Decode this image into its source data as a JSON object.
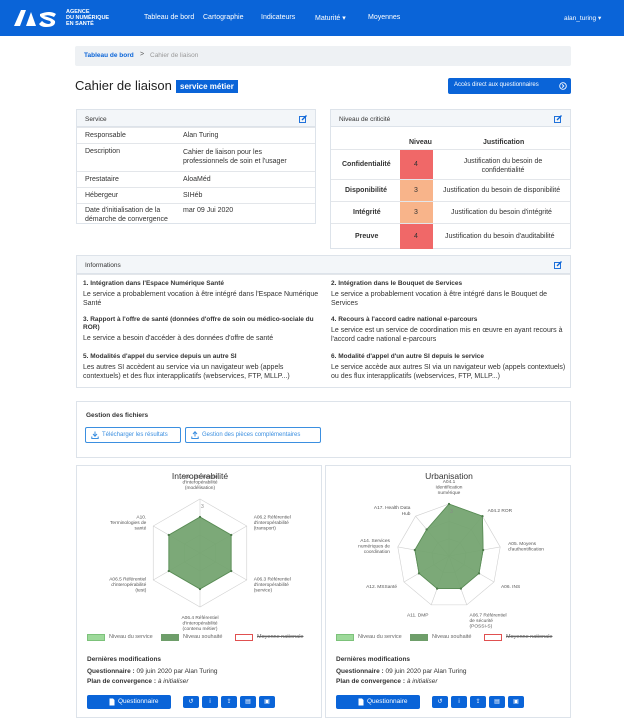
{
  "brand": {
    "line1": "AGENCE",
    "line2": "DU NUMÉRIQUE",
    "line3": "EN SANTÉ",
    "mark": "ANS"
  },
  "nav": {
    "items": [
      "Tableau de bord",
      "Cartographie",
      "Indicateurs",
      "Maturité ▾",
      "Moyennes"
    ],
    "user": "alan_turing ▾"
  },
  "breadcrumb": {
    "home": "Tableau de bord",
    "sep": ">",
    "current": "Cahier de liaison"
  },
  "page": {
    "title": "Cahier de liaison",
    "badge": "service métier",
    "quick_button": "Accès direct aux questionnaires"
  },
  "service": {
    "header": "Service",
    "rows": [
      {
        "label": "Responsable",
        "value": "Alan Turing"
      },
      {
        "label": "Description",
        "value": "Cahier de liaison pour les professionnels de soin et l'usager"
      },
      {
        "label": "Prestataire",
        "value": "AloaMéd"
      },
      {
        "label": "Hébergeur",
        "value": "SIHéb"
      },
      {
        "label": "Date d'initialisation de la démarche de convergence",
        "value": "mar 09 Jui 2020"
      }
    ]
  },
  "criticite": {
    "header": "Niveau de criticité",
    "col_level": "Niveau",
    "col_justif": "Justification",
    "rows": [
      {
        "label": "Confidentialité",
        "level": "4",
        "color": "#f06868",
        "justif": "Justification du besoin de confidentialité"
      },
      {
        "label": "Disponibilité",
        "level": "3",
        "color": "#f8b48a",
        "justif": "Justification du besoin de disponibilité"
      },
      {
        "label": "Intégrité",
        "level": "3",
        "color": "#f8b48a",
        "justif": "Justification du besoin d'intégrité"
      },
      {
        "label": "Preuve",
        "level": "4",
        "color": "#f06868",
        "justif": "Justification du besoin d'auditabilité"
      }
    ]
  },
  "informations": {
    "header": "Informations",
    "items": [
      {
        "title": "1. Intégration dans l'Espace Numérique Santé",
        "text": "Le service a probablement vocation à être intégré dans l'Espace Numérique Santé"
      },
      {
        "title": "2. Intégration dans le Bouquet de Services",
        "text": "Le service a probablement vocation à être intégré dans le Bouquet de Services"
      },
      {
        "title": "3. Rapport à l'offre de santé (données d'offre de soin ou médico-sociale du ROR)",
        "text": "Le service a besoin d'accéder à des données d'offre de santé"
      },
      {
        "title": "4. Recours à l'accord cadre national e-parcours",
        "text": "Le service est un service de coordination mis en œuvre en ayant recours à l'accord cadre national e-parcours"
      },
      {
        "title": "5. Modalités d'appel du service depuis un autre SI",
        "text": "Les autres SI accèdent au service via un navigateur web (appels contextuels) et des flux interapplicatifs (webservices, FTP, MLLP...)"
      },
      {
        "title": "6. Modalité d'appel d'un autre SI depuis le service",
        "text": "Le service accède aux autres SI via un navigateur web (appels contextuels) ou des flux interapplicatifs (webservices, FTP, MLLP...)"
      }
    ]
  },
  "fichiers": {
    "title": "Gestion des fichiers",
    "btn_download": "Télécharger les résultats",
    "btn_manage": "Gestion des pièces complémentaires"
  },
  "chart_data": [
    {
      "type": "radar",
      "title": "Interopérabilité",
      "axes": [
        "A06.1 Référentiel d'interopérabilité (modélisation)",
        "A06.2 Référentiel d'interopérabilité (transport)",
        "A06.3 Référentiel d'interopérabilité (service)",
        "A06.4 Référentiel d'interopérabilité (contenu métier)",
        "A06.5 Référentiel d'interopérabilité (test)",
        "A10. Terminologies de santé"
      ],
      "rmax": 3,
      "scale_label": "3",
      "series": [
        {
          "name": "Niveau du service",
          "values": [
            2,
            2,
            2,
            2,
            2,
            2
          ],
          "color": "#9dd99a"
        },
        {
          "name": "Niveau souhaité",
          "values": [
            2,
            2,
            2,
            2,
            2,
            2
          ],
          "color": "#6e9e6a"
        },
        {
          "name": "Moyenne nationale",
          "values": [],
          "color": "#e05050"
        }
      ]
    },
    {
      "type": "radar",
      "title": "Urbanisation",
      "axes": [
        "A04.1 Identification numérique",
        "A04.2 ROR",
        "A05. Moyens d'authentification",
        "A06. INS",
        "A06.7 Référentiel de sécurité (POSSI-S)",
        "A11. DMP",
        "A12. MSSanté",
        "A14. Services numériques de coordination",
        "A17. Health Data Hub"
      ],
      "rmax": 3,
      "scale_label": "3",
      "series": [
        {
          "name": "Niveau du service",
          "values": [
            3,
            3,
            2,
            2,
            2,
            2,
            2,
            2,
            2
          ],
          "color": "#9dd99a"
        },
        {
          "name": "Niveau souhaité",
          "values": [
            3,
            3,
            2,
            2,
            2,
            2,
            2,
            2,
            2
          ],
          "color": "#6e9e6a"
        },
        {
          "name": "Moyenne nationale",
          "values": [],
          "color": "#e05050"
        }
      ]
    }
  ],
  "modifs": {
    "title": "Dernières modifications",
    "q_label": "Questionnaire :",
    "q_value": "09 juin 2020 par Alan Turing",
    "p_label": "Plan de convergence :",
    "p_value": "à initialiser",
    "btn": "Questionnaire"
  }
}
